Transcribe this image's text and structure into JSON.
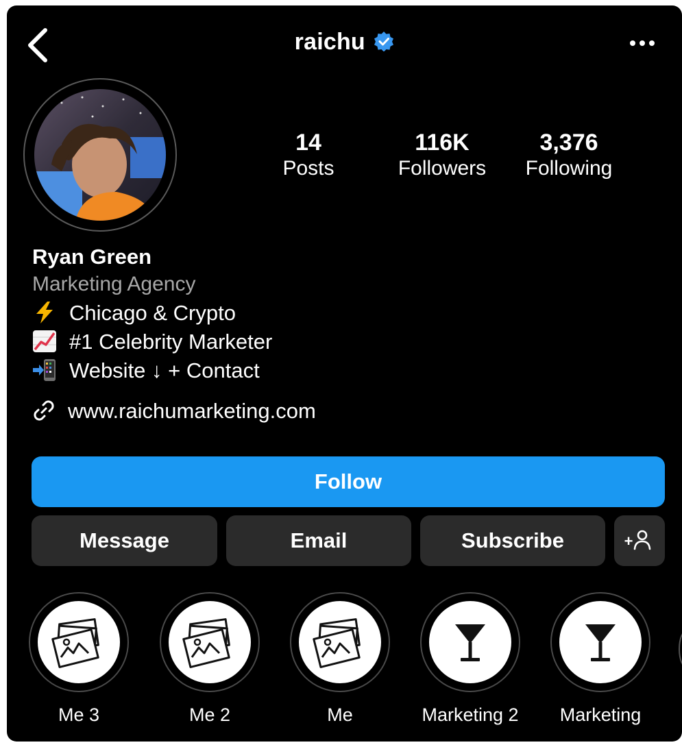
{
  "header": {
    "username": "raichu",
    "verified_icon": "verified-badge-icon",
    "back_icon": "chevron-left-icon",
    "more_icon": "more-horizontal-icon"
  },
  "stats": [
    {
      "value": "14",
      "label": "Posts"
    },
    {
      "value": "116K",
      "label": "Followers"
    },
    {
      "value": "3,376",
      "label": "Following"
    }
  ],
  "profile": {
    "name": "Ryan Green",
    "category": "Marketing Agency",
    "bio_lines": [
      {
        "icon": "lightning-emoji",
        "text": "Chicago & Crypto"
      },
      {
        "icon": "chart-increasing-emoji",
        "text": "#1 Celebrity Marketer"
      },
      {
        "icon": "mobile-arrow-emoji",
        "text": "Website ↓ + Contact"
      }
    ],
    "link": "www.raichumarketing.com",
    "link_icon": "link-icon"
  },
  "actions": {
    "follow": "Follow",
    "message": "Message",
    "email": "Email",
    "subscribe": "Subscribe",
    "suggest_icon": "add-person-icon",
    "suggest_text": "+"
  },
  "highlights": [
    {
      "label": "Me 3",
      "icon": "photos-icon"
    },
    {
      "label": "Me 2",
      "icon": "photos-icon"
    },
    {
      "label": "Me",
      "icon": "photos-icon"
    },
    {
      "label": "Marketing 2",
      "icon": "cocktail-glass-icon"
    },
    {
      "label": "Marketing",
      "icon": "cocktail-glass-icon"
    }
  ],
  "colors": {
    "background": "#000000",
    "follow_button": "#1a98f2",
    "secondary_button": "#2b2b2b",
    "verified": "#3897f0",
    "muted_text": "#a8a8a8"
  }
}
